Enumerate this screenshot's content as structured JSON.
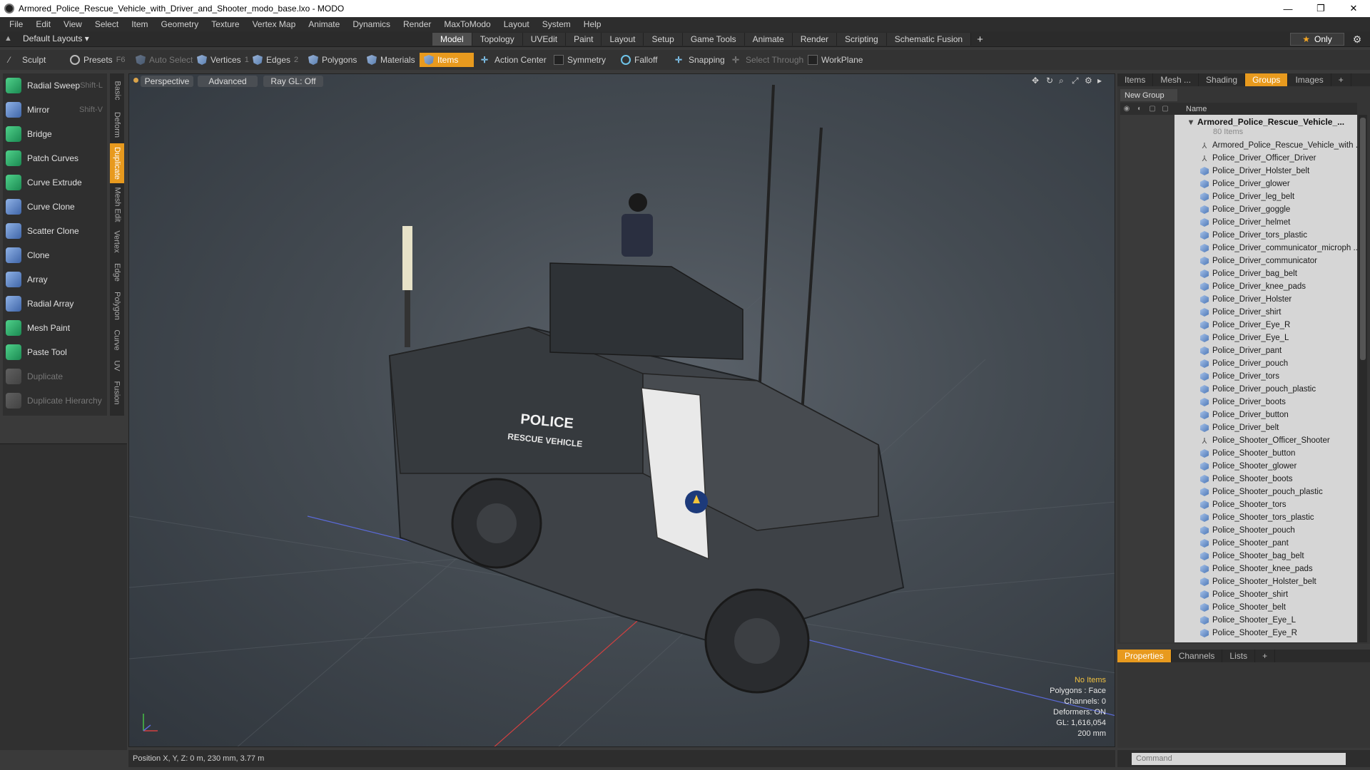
{
  "window": {
    "title": "Armored_Police_Rescue_Vehicle_with_Driver_and_Shooter_modo_base.lxo - MODO",
    "minimize": "—",
    "maximize": "❐",
    "close": "✕"
  },
  "menu": [
    "File",
    "Edit",
    "View",
    "Select",
    "Item",
    "Geometry",
    "Texture",
    "Vertex Map",
    "Animate",
    "Dynamics",
    "Render",
    "MaxToModo",
    "Layout",
    "System",
    "Help"
  ],
  "layouts": {
    "label": "Default Layouts ▾",
    "tabs": [
      "Model",
      "Topology",
      "UVEdit",
      "Paint",
      "Layout",
      "Setup",
      "Game Tools",
      "Animate",
      "Render",
      "Scripting",
      "Schematic Fusion"
    ],
    "active_tab": "Model",
    "add": "+",
    "only": "Only"
  },
  "toolbar": {
    "sculpt": "Sculpt",
    "presets": "Presets",
    "presets_key": "F6",
    "auto_select": "Auto Select",
    "vertices": "Vertices",
    "vertices_key": "1",
    "edges": "Edges",
    "edges_key": "2",
    "polygons": "Polygons",
    "materials": "Materials",
    "items": "Items",
    "action_center": "Action Center",
    "symmetry": "Symmetry",
    "falloff": "Falloff",
    "snapping": "Snapping",
    "select_through": "Select Through",
    "workplane": "WorkPlane"
  },
  "tools": [
    {
      "label": "Radial Sweep",
      "key": "Shift-L",
      "color": "green"
    },
    {
      "label": "Mirror",
      "key": "Shift-V",
      "color": "blue"
    },
    {
      "label": "Bridge",
      "key": "",
      "color": "green"
    },
    {
      "label": "Patch Curves",
      "key": "",
      "color": "green"
    },
    {
      "label": "Curve Extrude",
      "key": "",
      "color": "green"
    },
    {
      "label": "Curve Clone",
      "key": "",
      "color": "blue"
    },
    {
      "label": "Scatter Clone",
      "key": "",
      "color": "blue"
    },
    {
      "label": "Clone",
      "key": "",
      "color": "blue"
    },
    {
      "label": "Array",
      "key": "",
      "color": "blue"
    },
    {
      "label": "Radial Array",
      "key": "",
      "color": "blue"
    },
    {
      "label": "Mesh Paint",
      "key": "",
      "color": "green"
    },
    {
      "label": "Paste Tool",
      "key": "",
      "color": "green"
    },
    {
      "label": "Duplicate",
      "key": "",
      "color": "gray"
    },
    {
      "label": "Duplicate Hierarchy",
      "key": "",
      "color": "gray"
    }
  ],
  "vtabs": [
    "Basic",
    "Deform",
    "Duplicate",
    "Mesh Edit",
    "Vertex",
    "Edge",
    "Polygon",
    "Curve",
    "UV",
    "Fusion"
  ],
  "vtab_active": "Duplicate",
  "viewport": {
    "perspective": "Perspective",
    "advanced": "Advanced",
    "raygl": "Ray GL: Off",
    "info": {
      "no_items": "No Items",
      "polygons": "Polygons : Face",
      "channels": "Channels: 0",
      "deformers": "Deformers: ON",
      "gl": "GL: 1,616,054",
      "scale": "200 mm"
    },
    "vehicle_text_1": "POLICE",
    "vehicle_text_2": "RESCUE VEHICLE"
  },
  "status": {
    "position": "Position X, Y, Z:  0 m, 230 mm, 3.77 m"
  },
  "right": {
    "tabs": [
      "Items",
      "Mesh ...",
      "Shading",
      "Groups",
      "Images"
    ],
    "active_tab": "Groups",
    "add": "+",
    "new_group": "New Group",
    "name_header": "Name",
    "group_name": "Armored_Police_Rescue_Vehicle_...",
    "group_count": "80 Items",
    "items": [
      {
        "label": "Armored_Police_Rescue_Vehicle_with ...",
        "type": "loc"
      },
      {
        "label": "Police_Driver_Officer_Driver",
        "type": "loc"
      },
      {
        "label": "Police_Driver_Holster_belt",
        "type": "mesh"
      },
      {
        "label": "Police_Driver_glower",
        "type": "mesh"
      },
      {
        "label": "Police_Driver_leg_belt",
        "type": "mesh"
      },
      {
        "label": "Police_Driver_goggle",
        "type": "mesh"
      },
      {
        "label": "Police_Driver_helmet",
        "type": "mesh"
      },
      {
        "label": "Police_Driver_tors_plastic",
        "type": "mesh"
      },
      {
        "label": "Police_Driver_communicator_microph ...",
        "type": "mesh"
      },
      {
        "label": "Police_Driver_communicator",
        "type": "mesh"
      },
      {
        "label": "Police_Driver_bag_belt",
        "type": "mesh"
      },
      {
        "label": "Police_Driver_knee_pads",
        "type": "mesh"
      },
      {
        "label": "Police_Driver_Holster",
        "type": "mesh"
      },
      {
        "label": "Police_Driver_shirt",
        "type": "mesh"
      },
      {
        "label": "Police_Driver_Eye_R",
        "type": "mesh"
      },
      {
        "label": "Police_Driver_Eye_L",
        "type": "mesh"
      },
      {
        "label": "Police_Driver_pant",
        "type": "mesh"
      },
      {
        "label": "Police_Driver_pouch",
        "type": "mesh"
      },
      {
        "label": "Police_Driver_tors",
        "type": "mesh"
      },
      {
        "label": "Police_Driver_pouch_plastic",
        "type": "mesh"
      },
      {
        "label": "Police_Driver_boots",
        "type": "mesh"
      },
      {
        "label": "Police_Driver_button",
        "type": "mesh"
      },
      {
        "label": "Police_Driver_belt",
        "type": "mesh"
      },
      {
        "label": "Police_Shooter_Officer_Shooter",
        "type": "loc"
      },
      {
        "label": "Police_Shooter_button",
        "type": "mesh"
      },
      {
        "label": "Police_Shooter_glower",
        "type": "mesh"
      },
      {
        "label": "Police_Shooter_boots",
        "type": "mesh"
      },
      {
        "label": "Police_Shooter_pouch_plastic",
        "type": "mesh"
      },
      {
        "label": "Police_Shooter_tors",
        "type": "mesh"
      },
      {
        "label": "Police_Shooter_tors_plastic",
        "type": "mesh"
      },
      {
        "label": "Police_Shooter_pouch",
        "type": "mesh"
      },
      {
        "label": "Police_Shooter_pant",
        "type": "mesh"
      },
      {
        "label": "Police_Shooter_bag_belt",
        "type": "mesh"
      },
      {
        "label": "Police_Shooter_knee_pads",
        "type": "mesh"
      },
      {
        "label": "Police_Shooter_Holster_belt",
        "type": "mesh"
      },
      {
        "label": "Police_Shooter_shirt",
        "type": "mesh"
      },
      {
        "label": "Police_Shooter_belt",
        "type": "mesh"
      },
      {
        "label": "Police_Shooter_Eye_L",
        "type": "mesh"
      },
      {
        "label": "Police_Shooter_Eye_R",
        "type": "mesh"
      }
    ],
    "props_tabs": [
      "Properties",
      "Channels",
      "Lists"
    ],
    "props_active": "Properties",
    "command_placeholder": "Command"
  },
  "colors": {
    "accent": "#e89a1e",
    "info_warning": "#f0c040"
  }
}
